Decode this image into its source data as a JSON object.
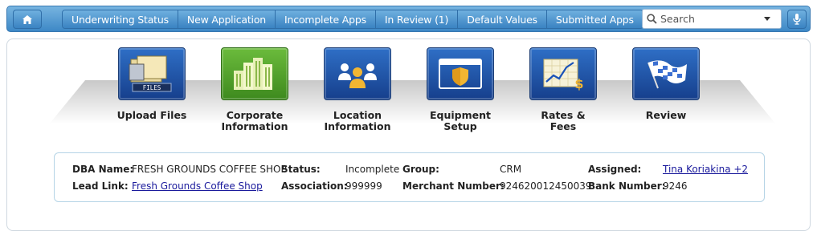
{
  "nav": {
    "items": [
      {
        "label": "Underwriting Status"
      },
      {
        "label": "New Application"
      },
      {
        "label": "Incomplete Apps"
      },
      {
        "label": "In Review (1)"
      },
      {
        "label": "Default Values"
      },
      {
        "label": "Submitted Apps"
      }
    ],
    "search_placeholder": "Search"
  },
  "steps": [
    {
      "label": "Upload Files",
      "icon": "upload-files-icon",
      "icon_text": "FILES"
    },
    {
      "label": "Corporate Information",
      "icon": "building-icon"
    },
    {
      "label": "Location Information",
      "icon": "people-icon"
    },
    {
      "label": "Equipment Setup",
      "icon": "shield-window-icon"
    },
    {
      "label": "Rates & Fees",
      "icon": "chart-dollar-icon"
    },
    {
      "label": "Review",
      "icon": "checkered-flag-icon"
    }
  ],
  "merchant": {
    "dba_label": "DBA Name:",
    "dba_value": "FRESH GROUNDS COFFEE SHOP",
    "lead_label": "Lead Link:",
    "lead_value": "Fresh Grounds Coffee Shop",
    "status_label": "Status:",
    "status_value": "Incomplete",
    "association_label": "Association:",
    "association_value": "999999",
    "group_label": "Group:",
    "group_value": "CRM",
    "merchant_number_label": "Merchant Number:",
    "merchant_number_value": "924620012450039",
    "assigned_label": "Assigned:",
    "assigned_value": "Tina Koriakina +2",
    "bank_number_label": "Bank Number:",
    "bank_number_value": "9246"
  },
  "colors": {
    "bar": "#4a95d0",
    "step_blue": "#1f55a8",
    "step_green": "#57a82e",
    "link": "#1a1a9c"
  }
}
